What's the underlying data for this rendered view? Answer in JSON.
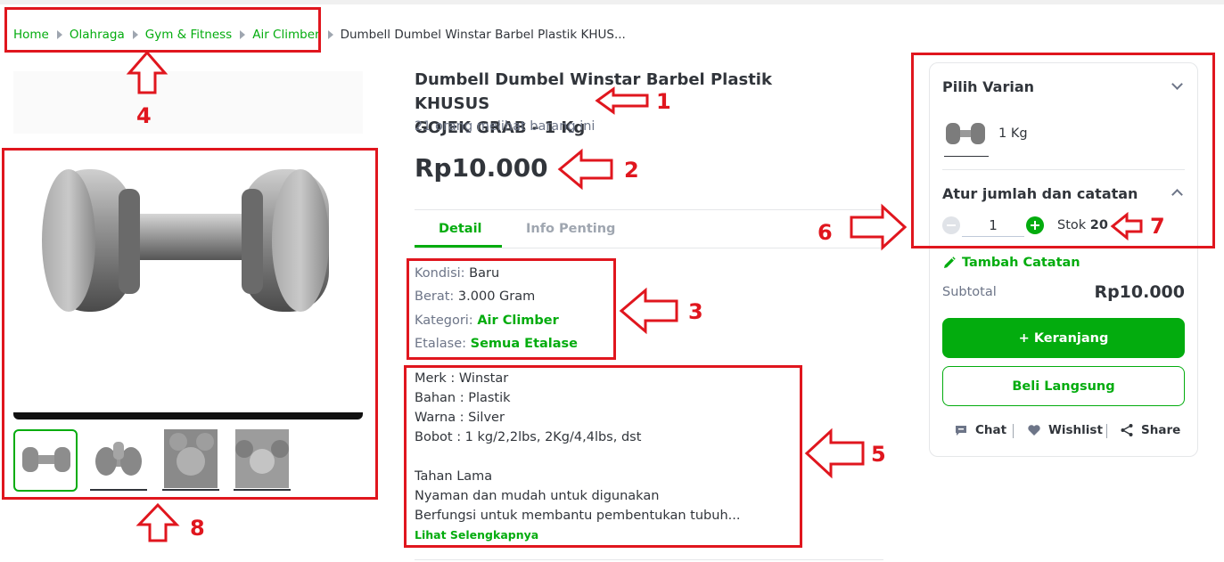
{
  "breadcrumb": {
    "items": [
      "Home",
      "Olahraga",
      "Gym & Fitness",
      "Air Climber"
    ],
    "current": "Dumbell Dumbel Winstar Barbel Plastik KHUS..."
  },
  "product": {
    "title_line1": "Dumbell Dumbel Winstar Barbel Plastik KHUSUS",
    "title_line2": "GOJEK GRAB - 1 Kg",
    "viewers": "21 orang melihat barang ini",
    "price": "Rp10.000"
  },
  "tabs": [
    "Detail",
    "Info Penting"
  ],
  "specs": [
    {
      "label": "Kondisi: ",
      "value": "Baru"
    },
    {
      "label": "Berat: ",
      "value": "3.000 Gram"
    },
    {
      "label": "Kategori: ",
      "value": "Air Climber"
    },
    {
      "label": "Etalase: ",
      "value": "Semua Etalase"
    }
  ],
  "description": [
    "Merk : Winstar",
    "Bahan : Plastik",
    "Warna : Silver",
    "Bobot : 1 kg/2,2lbs, 2Kg/4,4lbs, dst",
    "",
    "Tahan Lama",
    "Nyaman dan mudah untuk digunakan",
    "Berfungsi untuk membantu pembentukan tubuh..."
  ],
  "read_more": "Lihat Selengkapnya",
  "card": {
    "variant_title": "Pilih Varian",
    "variant_label": "1 Kg",
    "qty_title": "Atur jumlah dan catatan",
    "qty_value": "1",
    "stock_label": "Stok ",
    "stock_value": "20",
    "add_note": "Tambah Catatan",
    "subtotal_label": "Subtotal",
    "subtotal_value": "Rp10.000",
    "cart_button": "+ Keranjang",
    "buy_button": "Beli Langsung",
    "actions": [
      "Chat",
      "Wishlist",
      "Share"
    ]
  },
  "annotations": [
    "1",
    "2",
    "3",
    "4",
    "5",
    "6",
    "7",
    "8"
  ],
  "colors": {
    "accent": "#03ac0e",
    "annotation": "#e0161e",
    "text": "#31353b",
    "muted": "#6d7588"
  }
}
